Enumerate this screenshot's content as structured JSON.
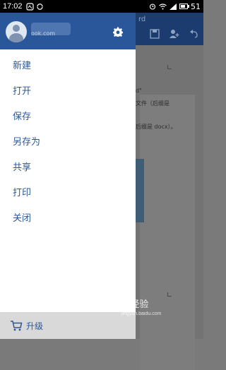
{
  "status_bar": {
    "time": "17:02",
    "battery": "51"
  },
  "document": {
    "title_fragment": "rd",
    "lines": [
      "d\"",
      "文件（后缀是",
      "后缀是 docx）。"
    ]
  },
  "drawer": {
    "account_email": "ook.com",
    "menu": [
      "新建",
      "打开",
      "保存",
      "另存为",
      "共享",
      "打印",
      "关闭"
    ],
    "upgrade_label": "升级"
  },
  "watermark": {
    "brand": "Bai 经验",
    "url": "jingyan.baidu.com"
  },
  "colors": {
    "header": "#2a579a",
    "menu_text": "#2b5797",
    "upgrade_bg": "#d9d9d9"
  }
}
